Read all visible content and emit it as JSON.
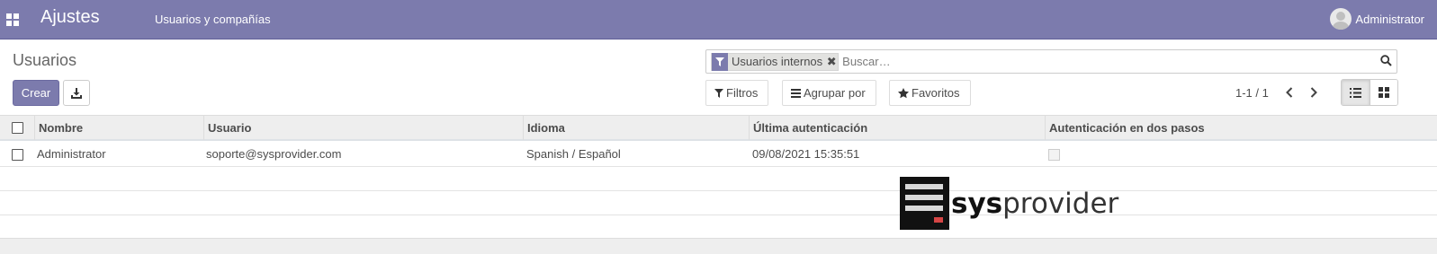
{
  "navbar": {
    "app_title": "Ajustes",
    "menu_item": "Usuarios y compañías",
    "user_name": "Administrator",
    "color": "#7c7bad"
  },
  "control_panel": {
    "breadcrumb": "Usuarios",
    "create_label": "Crear",
    "search": {
      "facet_label": "Usuarios internos",
      "placeholder": "Buscar…"
    },
    "filters_label": "Filtros",
    "group_by_label": "Agrupar por",
    "favorites_label": "Favoritos",
    "pager": "1-1 / 1",
    "active_view": "list"
  },
  "table": {
    "columns": [
      "Nombre",
      "Usuario",
      "Idioma",
      "Última autenticación",
      "Autenticación en dos pasos"
    ],
    "rows": [
      {
        "nombre": "Administrator",
        "usuario": "soporte@sysprovider.com",
        "idioma": "Spanish / Español",
        "ultima_autenticacion": "09/08/2021 15:35:51",
        "dos_pasos": false
      }
    ]
  },
  "watermark": {
    "text_bold": "sys",
    "text_rest": "provider"
  }
}
